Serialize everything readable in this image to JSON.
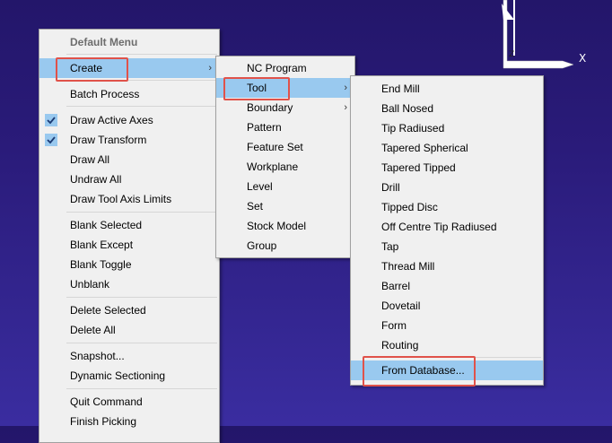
{
  "axes": {
    "x_label": "X",
    "z_label": "Z"
  },
  "main_menu": {
    "title": "Default Menu",
    "items": [
      {
        "label": "Create",
        "arrow": "›"
      },
      {
        "label": "Batch Process"
      },
      {
        "label": "Draw Active Axes",
        "checked": true
      },
      {
        "label": "Draw Transform",
        "checked": true
      },
      {
        "label": "Draw All"
      },
      {
        "label": "Undraw All"
      },
      {
        "label": "Draw Tool Axis Limits"
      },
      {
        "label": "Blank Selected"
      },
      {
        "label": "Blank Except"
      },
      {
        "label": "Blank Toggle"
      },
      {
        "label": "Unblank"
      },
      {
        "label": "Delete Selected"
      },
      {
        "label": "Delete All"
      },
      {
        "label": "Snapshot..."
      },
      {
        "label": "Dynamic Sectioning"
      },
      {
        "label": "Quit Command"
      },
      {
        "label": "Finish Picking"
      }
    ]
  },
  "create_menu": {
    "items": [
      {
        "label": "NC Program"
      },
      {
        "label": "Tool",
        "arrow": "›"
      },
      {
        "label": "Boundary",
        "arrow": "›"
      },
      {
        "label": "Pattern"
      },
      {
        "label": "Feature Set"
      },
      {
        "label": "Workplane"
      },
      {
        "label": "Level"
      },
      {
        "label": "Set"
      },
      {
        "label": "Stock Model"
      },
      {
        "label": "Group"
      }
    ]
  },
  "tool_menu": {
    "items": [
      {
        "label": "End Mill"
      },
      {
        "label": "Ball Nosed"
      },
      {
        "label": "Tip Radiused"
      },
      {
        "label": "Tapered Spherical"
      },
      {
        "label": "Tapered Tipped"
      },
      {
        "label": "Drill"
      },
      {
        "label": "Tipped Disc"
      },
      {
        "label": "Off Centre Tip Radiused"
      },
      {
        "label": "Tap"
      },
      {
        "label": "Thread Mill"
      },
      {
        "label": "Barrel"
      },
      {
        "label": "Dovetail"
      },
      {
        "label": "Form"
      },
      {
        "label": "Routing"
      },
      {
        "label": "From Database..."
      }
    ]
  },
  "colors": {
    "highlight": "#99c9ef",
    "annotation": "#e0524a"
  }
}
